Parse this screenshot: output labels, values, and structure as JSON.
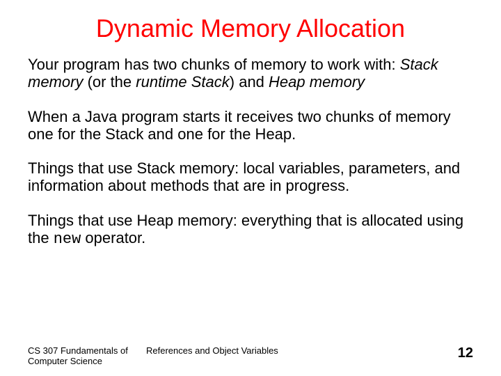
{
  "title": "Dynamic Memory Allocation",
  "p1": {
    "a": "Your program has two chunks of memory to work with: ",
    "b": "Stack memory",
    "c": " (or the ",
    "d": "runtime Stack",
    "e": ") and ",
    "f": "Heap memory"
  },
  "p2": "When a Java program starts it receives two chunks of memory one for the Stack and one for the Heap.",
  "p3": "Things that use Stack memory: local variables, parameters, and information about methods that are in progress.",
  "p4": {
    "a": "Things that use Heap memory: everything that is allocated using the ",
    "b": "new",
    "c": " operator."
  },
  "footer": {
    "left": "CS 307 Fundamentals of Computer Science",
    "center": "References and Object Variables",
    "page": "12"
  }
}
